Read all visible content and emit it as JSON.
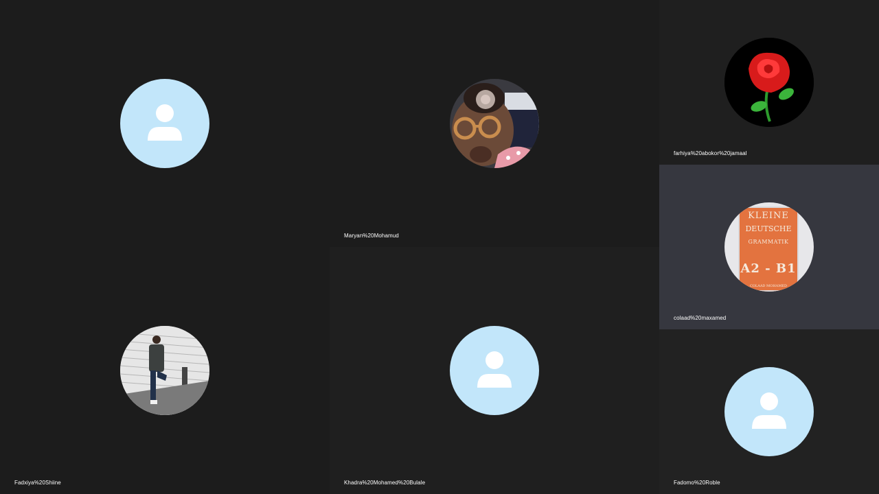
{
  "participants": [
    {
      "id": "p1",
      "name": "",
      "avatar": "default-user-icon"
    },
    {
      "id": "p2",
      "name": "Maryan%20Mohamud",
      "avatar": "photo-child-with-glasses"
    },
    {
      "id": "p3",
      "name": "Fadxiya%20Shiine",
      "avatar": "photo-man-by-brick-wall"
    },
    {
      "id": "p4",
      "name": "Khadra%20Mohamed%20Bulale",
      "avatar": "default-user-icon"
    },
    {
      "id": "p5",
      "name": "farhiya%20abokor%20jamaal",
      "avatar": "red-rose-image"
    },
    {
      "id": "p6",
      "name": "colaad%20maxamed",
      "avatar": "book-cover-image"
    },
    {
      "id": "p7",
      "name": "Fadomo%20Roble",
      "avatar": "default-user-icon"
    }
  ],
  "book_cover": {
    "line1": "KLEINE",
    "line2": "DEUTSCHE",
    "line3": "GRAMMATIK",
    "line4": "A2 - B1",
    "line5": "COLAAD MOHAMED"
  },
  "colors": {
    "background": "#1c1c1c",
    "highlight_tile": "#36373f",
    "default_avatar": "#c2e6fa"
  }
}
